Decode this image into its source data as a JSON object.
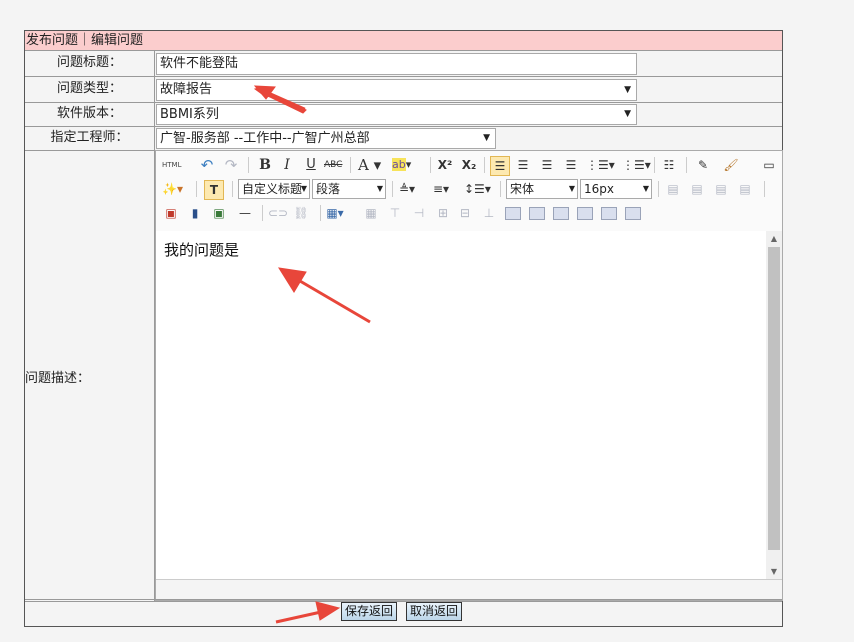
{
  "header": {
    "title": "发布问题｜编辑问题"
  },
  "form": {
    "title_label": "问题标题：",
    "title_value": "软件不能登陆",
    "type_label": "问题类型：",
    "type_value": "故障报告",
    "version_label": "软件版本：",
    "version_value": "BBMI系列",
    "engineer_label": "指定工程师：",
    "engineer_value": "广智-服务部 --工作中--广智广州总部",
    "desc_label": "问题描述："
  },
  "editor": {
    "content": "我的问题是",
    "style_dropdown": "自定义标题",
    "paragraph_dropdown": "段落",
    "font_dropdown": "宋体",
    "size_dropdown": "16px",
    "html_label": "HTML"
  },
  "footer": {
    "save_label": "保存返回",
    "cancel_label": "取消返回"
  },
  "colors": {
    "header_bg": "#fbcdcd",
    "annotation_arrow": "#e8463a"
  }
}
